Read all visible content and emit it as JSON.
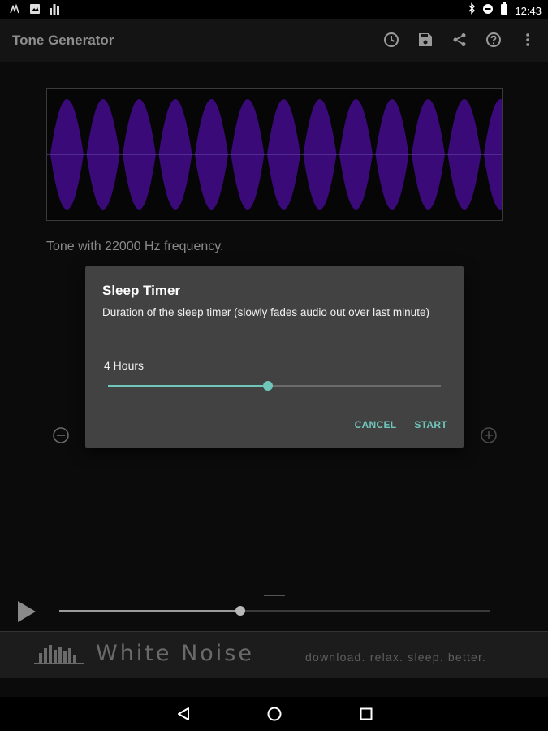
{
  "status_bar": {
    "time": "12:43",
    "left_icons": [
      "usb-debug-icon",
      "image-notification-icon",
      "equalizer-notification-icon"
    ],
    "right_icons": [
      "bluetooth-icon",
      "do-not-disturb-icon",
      "battery-icon"
    ]
  },
  "app_bar": {
    "title": "Tone Generator",
    "actions": [
      "timer-icon",
      "save-icon",
      "share-icon",
      "help-icon",
      "overflow-menu-icon"
    ]
  },
  "tone": {
    "description": "Tone with 22000 Hz frequency.",
    "wave_color": "#3a0a78"
  },
  "dialog": {
    "title": "Sleep Timer",
    "message": "Duration of the sleep timer (slowly fades audio out over last minute)",
    "value_label": "4 Hours",
    "slider_fraction": 0.48,
    "cancel_label": "CANCEL",
    "start_label": "START",
    "accent_color": "#6fc6bb"
  },
  "player": {
    "progress_fraction": 0.42
  },
  "ad_banner": {
    "brand": "White Noise",
    "tagline": "download. relax. sleep. better."
  }
}
